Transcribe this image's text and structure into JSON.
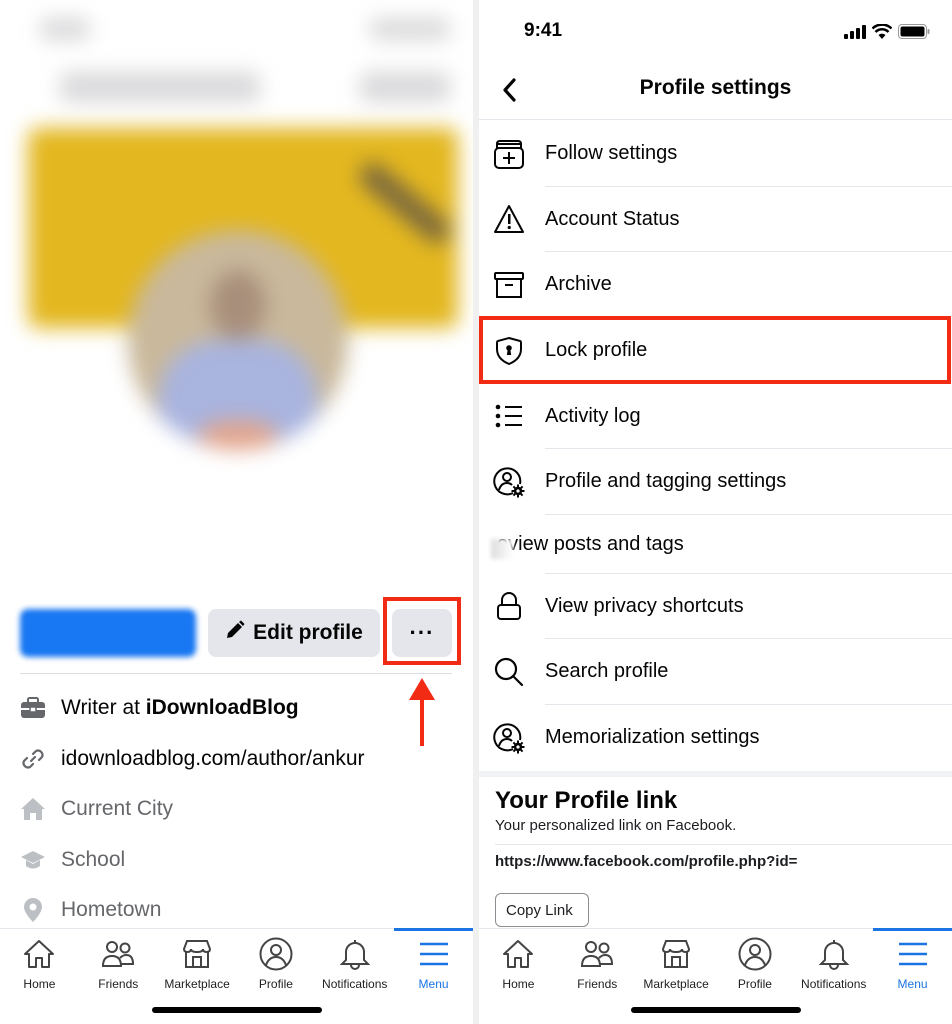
{
  "left": {
    "buttons": {
      "add_story": "",
      "edit_profile": "Edit profile",
      "more": "···"
    },
    "about": [
      {
        "icon": "briefcase-icon",
        "text_plain": "Writer at ",
        "text_bold": "iDownloadBlog",
        "style": "dark"
      },
      {
        "icon": "link-icon",
        "text_plain": "idownloadblog.com/author/ankur",
        "text_bold": "",
        "style": "dark"
      },
      {
        "icon": "home-icon",
        "text_plain": "Current City",
        "text_bold": "",
        "style": "muted"
      },
      {
        "icon": "graduation-cap-icon",
        "text_plain": "School",
        "text_bold": "",
        "style": "muted"
      },
      {
        "icon": "location-pin-icon",
        "text_plain": "Hometown",
        "text_bold": "",
        "style": "muted"
      }
    ]
  },
  "right": {
    "status_bar": {
      "time": "9:41"
    },
    "header": {
      "title": "Profile settings"
    },
    "menu": [
      {
        "icon": "follow-settings-icon",
        "label": "Follow settings"
      },
      {
        "icon": "warning-icon",
        "label": "Account Status"
      },
      {
        "icon": "archive-icon",
        "label": "Archive"
      },
      {
        "icon": "shield-lock-icon",
        "label": "Lock profile"
      },
      {
        "icon": "list-icon",
        "label": "Activity log"
      },
      {
        "icon": "user-gear-icon",
        "label": "Profile and tagging settings"
      },
      {
        "icon": "",
        "label": "eview posts and tags"
      },
      {
        "icon": "lock-icon",
        "label": "View privacy shortcuts"
      },
      {
        "icon": "search-icon",
        "label": "Search profile"
      },
      {
        "icon": "user-gear-icon",
        "label": "Memorialization settings"
      }
    ],
    "profile_link": {
      "title": "Your Profile link",
      "subtitle": "Your personalized link on Facebook.",
      "url": "https://www.facebook.com/profile.php?id=",
      "copy_button": "Copy Link"
    }
  },
  "tabbar": {
    "tabs": [
      {
        "label": "Home",
        "icon": "home-icon"
      },
      {
        "label": "Friends",
        "icon": "friends-icon"
      },
      {
        "label": "Marketplace",
        "icon": "marketplace-icon"
      },
      {
        "label": "Profile",
        "icon": "profile-icon"
      },
      {
        "label": "Notifications",
        "icon": "bell-icon"
      },
      {
        "label": "Menu",
        "icon": "menu-icon",
        "active": true
      }
    ]
  },
  "colors": {
    "accent": "#1b74e4",
    "highlight": "#f22c14",
    "cover": "#e3b71f"
  }
}
